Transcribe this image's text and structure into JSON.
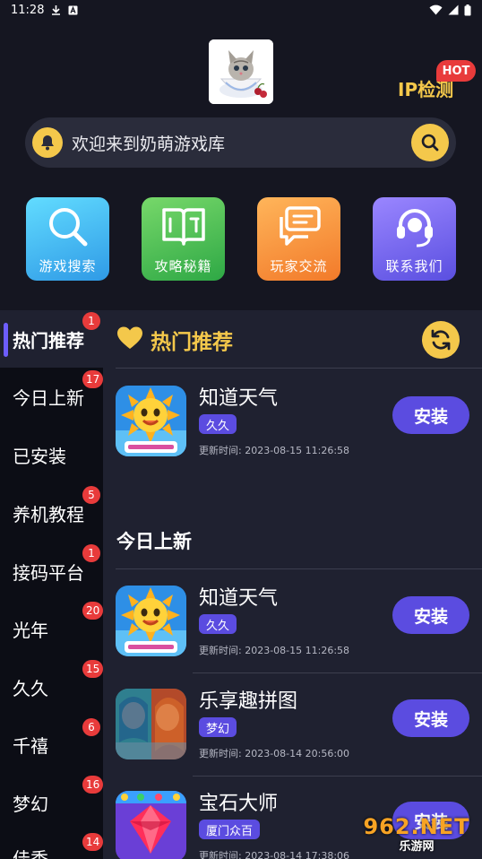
{
  "status_bar": {
    "time": "11:28"
  },
  "header": {
    "ip_check_label": "IP检测",
    "hot_badge": "HOT",
    "search_text": "欢迎来到奶萌游戏库"
  },
  "tiles": [
    {
      "label": "游戏搜索"
    },
    {
      "label": "攻略秘籍"
    },
    {
      "label": "玩家交流"
    },
    {
      "label": "联系我们"
    }
  ],
  "sidebar": {
    "items": [
      {
        "label": "热门推荐",
        "badge": "1"
      },
      {
        "label": "今日上新",
        "badge": "17"
      },
      {
        "label": "已安装",
        "badge": ""
      },
      {
        "label": "养机教程",
        "badge": "5"
      },
      {
        "label": "接码平台",
        "badge": "1"
      },
      {
        "label": "光年",
        "badge": "20"
      },
      {
        "label": "久久",
        "badge": "15"
      },
      {
        "label": "千禧",
        "badge": "6"
      },
      {
        "label": "梦幻",
        "badge": "16"
      },
      {
        "label": "佳秀",
        "badge": "14"
      }
    ]
  },
  "main": {
    "section_title": "热门推荐",
    "hot_apps": [
      {
        "name": "知道天气",
        "tag": "久久",
        "time": "更新时间: 2023-08-15 11:26:58",
        "button": "安装"
      }
    ],
    "new_title": "今日上新",
    "new_apps": [
      {
        "name": "知道天气",
        "tag": "久久",
        "time": "更新时间: 2023-08-15 11:26:58",
        "button": "安装"
      },
      {
        "name": "乐享趣拼图",
        "tag": "梦幻",
        "time": "更新时间: 2023-08-14 20:56:00",
        "button": "安装"
      },
      {
        "name": "宝石大师",
        "tag": "厦门众百",
        "time": "更新时间: 2023-08-14 17:38:06",
        "button": "安装"
      }
    ]
  },
  "watermark": {
    "line1": "962.NET",
    "line2": "乐游网"
  },
  "colors": {
    "accent": "#5b4ce0",
    "highlight": "#f4c84b",
    "badge": "#e83b3b"
  }
}
